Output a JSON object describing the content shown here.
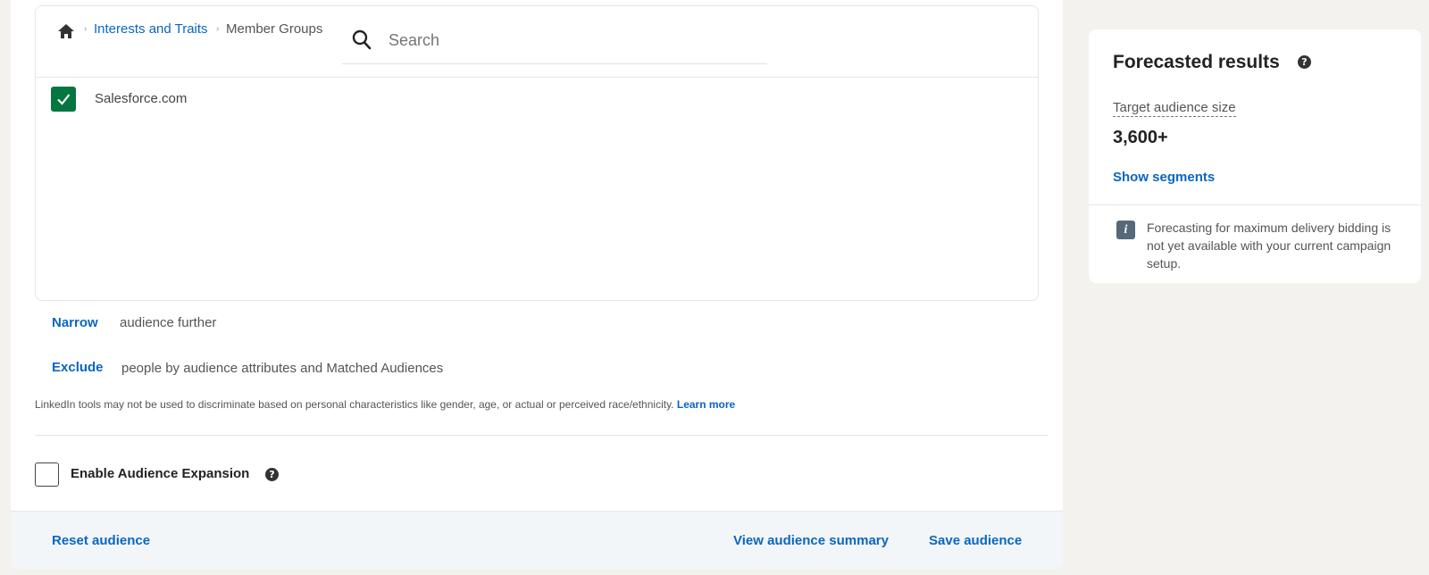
{
  "breadcrumb": {
    "home_icon": "home-icon",
    "level1": "Interests and Traits",
    "level2": "Member Groups"
  },
  "search": {
    "placeholder": "Search",
    "icon": "search-icon"
  },
  "results": [
    {
      "label": "Salesforce.com",
      "checked": true
    }
  ],
  "narrow": {
    "link": "Narrow",
    "text": "audience further"
  },
  "exclude": {
    "link": "Exclude",
    "text": "people by audience attributes and Matched Audiences"
  },
  "disclaimer": {
    "text": "LinkedIn tools may not be used to discriminate based on personal characteristics like gender, age, or actual or perceived race/ethnicity.",
    "link": "Learn more"
  },
  "expansion": {
    "label": "Enable Audience Expansion",
    "checked": false
  },
  "footer": {
    "reset": "Reset audience",
    "view_summary": "View audience summary",
    "save": "Save audience"
  },
  "forecast": {
    "title": "Forecasted results",
    "size_label": "Target audience size",
    "size_value": "3,600+",
    "segments_link": "Show segments",
    "info": "Forecasting for maximum delivery bidding is not yet available with your current campaign setup."
  },
  "colors": {
    "accent": "#0a66c2",
    "checkbox_checked": "#057642",
    "page_bg": "#f3f2ef",
    "info_icon_bg": "#56687a"
  }
}
